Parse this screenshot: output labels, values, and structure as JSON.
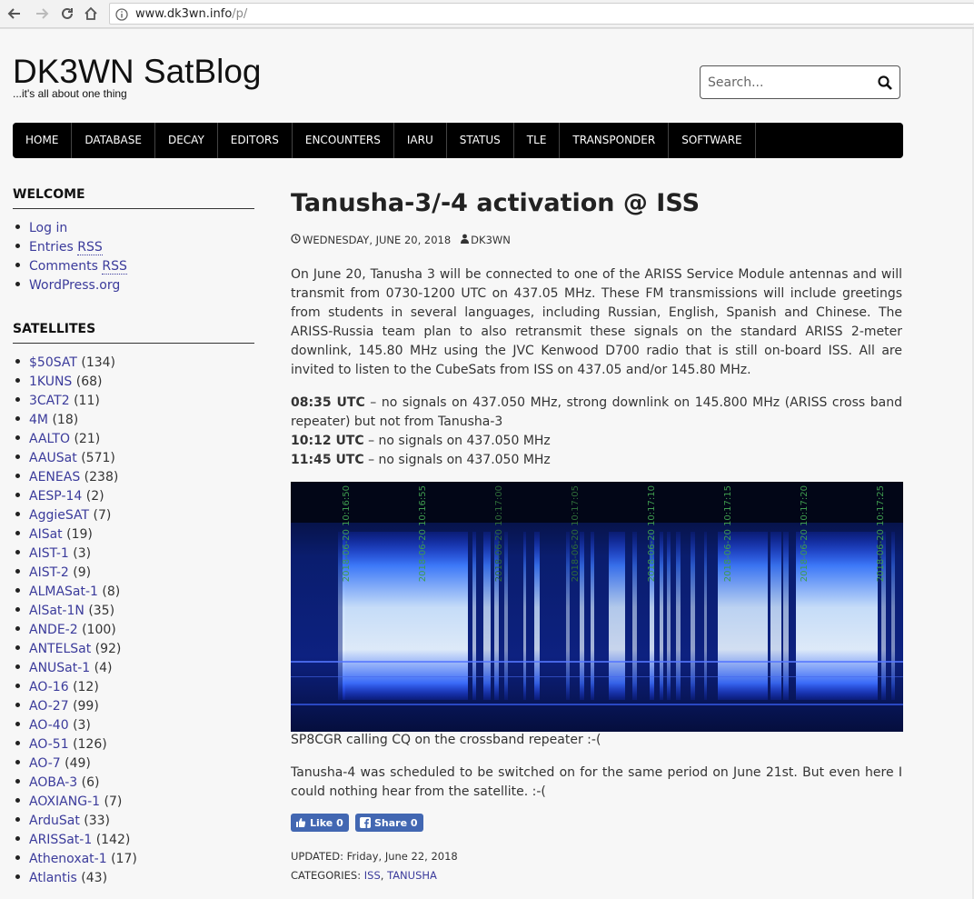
{
  "browser": {
    "url_host": "www.dk3wn.info",
    "url_path": "/p/"
  },
  "site": {
    "title": "DK3WN SatBlog",
    "tagline": "...it's all about one thing"
  },
  "search": {
    "placeholder": "Search..."
  },
  "menu": [
    "HOME",
    "DATABASE",
    "DECAY",
    "EDITORS",
    "ENCOUNTERS",
    "IARU",
    "STATUS",
    "TLE",
    "TRANSPONDER",
    "SOFTWARE"
  ],
  "welcome": {
    "title": "WELCOME",
    "items": [
      {
        "text": "Log in"
      },
      {
        "text": "Entries ",
        "rss": "RSS"
      },
      {
        "text": "Comments ",
        "rss": "RSS"
      },
      {
        "text": "WordPress.org"
      }
    ]
  },
  "satellites": {
    "title": "SATELLITES",
    "items": [
      {
        "name": "$50SAT",
        "count": "(134)"
      },
      {
        "name": "1KUNS",
        "count": "(68)"
      },
      {
        "name": "3CAT2",
        "count": "(11)"
      },
      {
        "name": "4M",
        "count": "(18)"
      },
      {
        "name": "AALTO",
        "count": "(21)"
      },
      {
        "name": "AAUSat",
        "count": "(571)"
      },
      {
        "name": "AENEAS",
        "count": "(238)"
      },
      {
        "name": "AESP-14",
        "count": "(2)"
      },
      {
        "name": "AggieSAT",
        "count": "(7)"
      },
      {
        "name": "AISat",
        "count": "(19)"
      },
      {
        "name": "AIST-1",
        "count": "(3)"
      },
      {
        "name": "AIST-2",
        "count": "(9)"
      },
      {
        "name": "ALMASat-1",
        "count": "(8)"
      },
      {
        "name": "AlSat-1N",
        "count": "(35)"
      },
      {
        "name": "ANDE-2",
        "count": "(100)"
      },
      {
        "name": "ANTELSat",
        "count": "(92)"
      },
      {
        "name": "ANUSat-1",
        "count": "(4)"
      },
      {
        "name": "AO-16",
        "count": "(12)"
      },
      {
        "name": "AO-27",
        "count": "(99)"
      },
      {
        "name": "AO-40",
        "count": "(3)"
      },
      {
        "name": "AO-51",
        "count": "(126)"
      },
      {
        "name": "AO-7",
        "count": "(49)"
      },
      {
        "name": "AOBA-3",
        "count": "(6)"
      },
      {
        "name": "AOXIANG-1",
        "count": "(7)"
      },
      {
        "name": "ArduSat",
        "count": "(33)"
      },
      {
        "name": "ARISSat-1",
        "count": "(142)"
      },
      {
        "name": "Athenoxat-1",
        "count": "(17)"
      },
      {
        "name": "Atlantis",
        "count": "(43)"
      }
    ]
  },
  "post": {
    "title": "Tanusha-3/-4 activation @ ISS",
    "date": "WEDNESDAY, JUNE 20, 2018",
    "author": "DK3WN",
    "intro": "On June 20, Tanusha 3 will be connected to one of the ARISS Service Module antennas and will transmit from 0730-1200 UTC on 437.05 MHz. These FM transmissions will include greetings from students in several languages, including Russian, English, Spanish and Chinese. The ARISS-Russia team plan to also retransmit these signals on the standard ARISS 2-meter downlink, 145.80 MHz using the JVC Kenwood D700 radio that is still on-board ISS. All are invited to listen to the CubeSats from ISS on 437.05 and/or 145.80 MHz.",
    "log": [
      {
        "time": "08:35 UTC",
        "text": " – no signals on 437.050 MHz, strong downlink on 145.800 MHz (ARISS cross band repeater) but not from Tanusha-3"
      },
      {
        "time": "10:12 UTC",
        "text": " – no signals on 437.050 MHz"
      },
      {
        "time": "11:45 UTC",
        "text": " – no signals on 437.050 MHz"
      }
    ],
    "spectrogram_labels": [
      "2018-06-20 10:16:50",
      "2018-06-20 10:16:55",
      "2018-06-20 10:17:00",
      "2018-06-20 10:17:05",
      "2018-06-20 10:17:10",
      "2018-06-20 10:17:15",
      "2018-06-20 10:17:20",
      "2018-06-20 10:17:25"
    ],
    "caption": "SP8CGR calling CQ on the crossband repeater :-(",
    "after": "Tanusha-4 was scheduled to be switched on for the same period on June 21st. But even here I could nothing hear from the satellite. :-(",
    "like_label": "Like 0",
    "share_label": "Share 0",
    "updated_label": "UPDATED: ",
    "updated_value": "Friday, June 22, 2018",
    "categories_label": "CATEGORIES: ",
    "categories": [
      "ISS",
      "TANUSHA"
    ],
    "category_sep": ", ",
    "colors": {
      "link": "#3b3b9b",
      "menu_bg": "#000000",
      "fb": "#4267b2"
    }
  }
}
